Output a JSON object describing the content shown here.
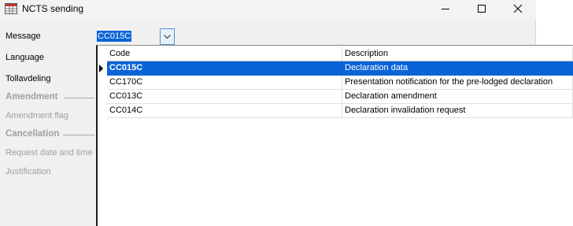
{
  "window": {
    "title": "NCTS sending"
  },
  "form": {
    "message_label": "Message",
    "message_value": "CC015C",
    "language_label": "Language",
    "customs_label": "Tollavdeling",
    "amendment_section": "Amendment",
    "amendment_flag_label": "Amendment flag",
    "cancellation_section": "Cancellation",
    "request_date_label": "Request date and time",
    "justification_label": "Justification"
  },
  "dropdown": {
    "columns": [
      "Code",
      "Description"
    ],
    "selected_index": 0,
    "rows": [
      {
        "code": "CC015C",
        "description": "Declaration data"
      },
      {
        "code": "CC170C",
        "description": "Presentation notification for the pre-lodged declaration"
      },
      {
        "code": "CC013C",
        "description": "Declaration amendment"
      },
      {
        "code": "CC014C",
        "description": "Declaration invalidation request"
      }
    ]
  },
  "colors": {
    "selection": "#0a64d8",
    "disabled_text": "#a0a0a0",
    "window_bg": "#f0f0f0"
  },
  "icons": {
    "app": "table-app-icon",
    "minimize": "minimize-icon",
    "maximize": "maximize-icon",
    "close": "close-icon",
    "combo": "chevron-down-icon",
    "row_indicator": "row-pointer-icon"
  }
}
